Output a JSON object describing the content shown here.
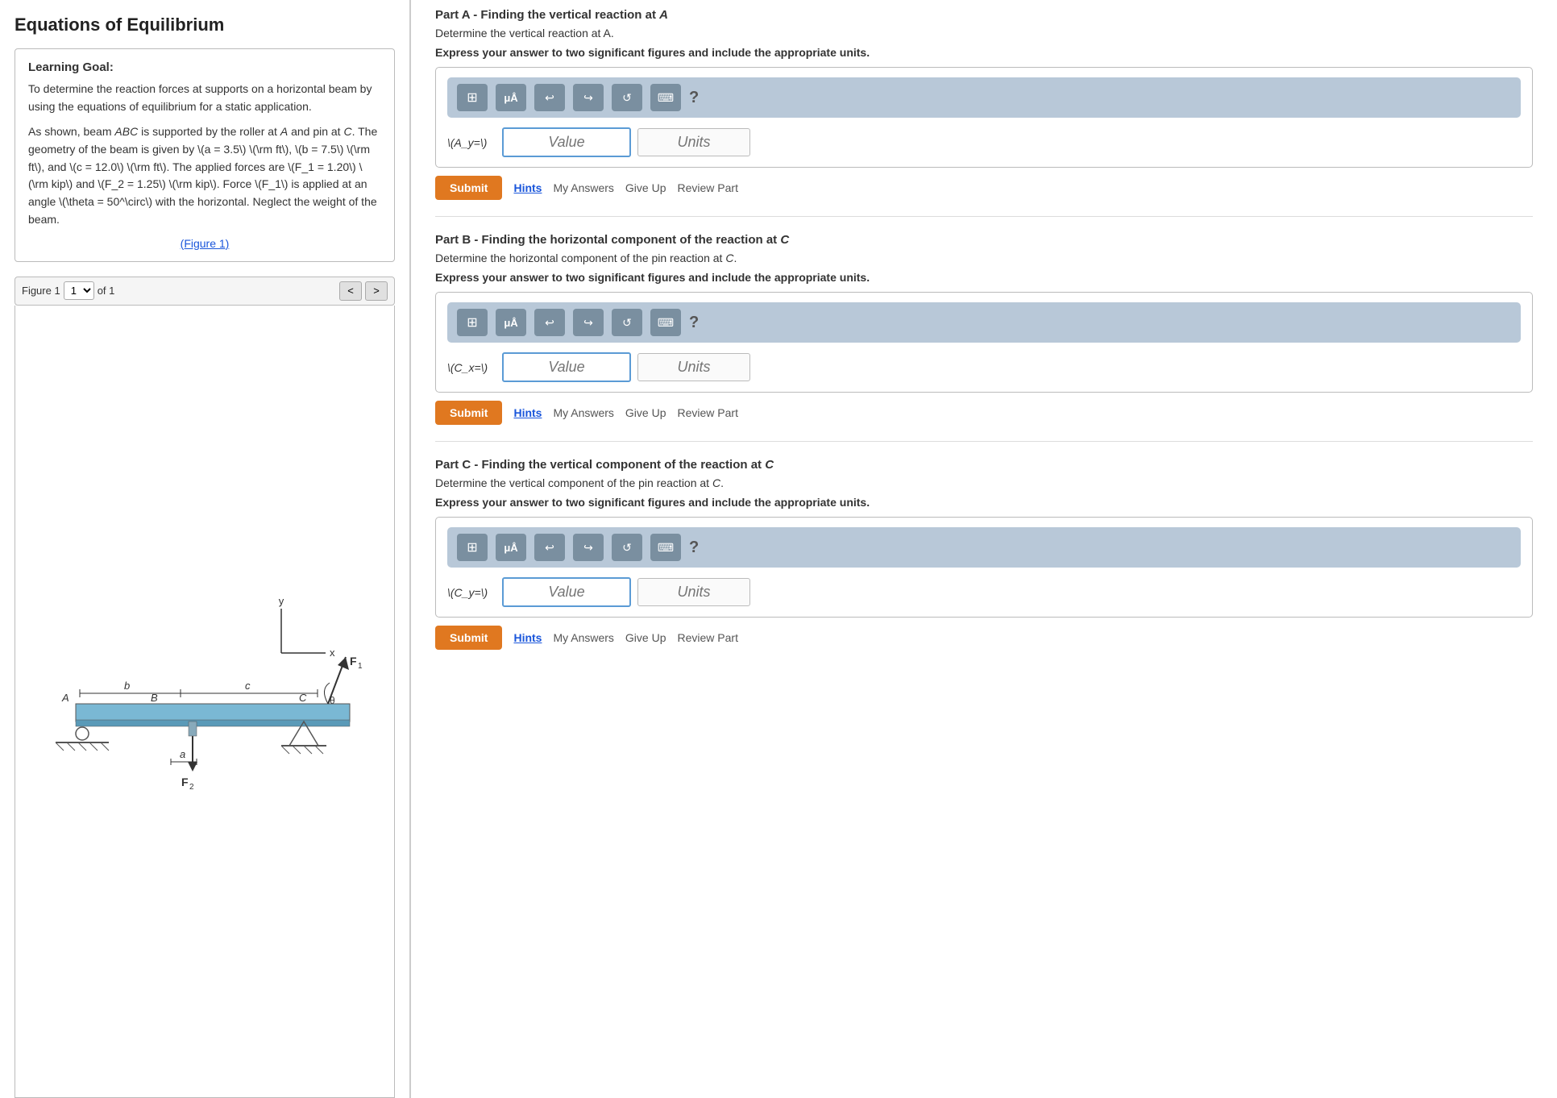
{
  "page": {
    "title": "Equations of Equilibrium"
  },
  "learning_goal": {
    "title": "Learning Goal:",
    "paragraphs": [
      "To determine the reaction forces at supports on a horizontal beam by using the equations of equilibrium for a static application.",
      "As shown, beam ABC is supported by the roller at A and pin at C. The geometry of the beam is given by \\(a = 3.5\\) \\(\\rm ft\\), \\(b = 7.5\\) \\(\\rm ft\\), and \\(c = 12.0\\) \\(\\rm ft\\). The applied forces are \\(F_1 = 1.20\\) \\(\\rm kip\\) and \\(F_2 = 1.25\\) \\(\\rm kip\\). Force \\(F_1\\) is applied at an angle \\(\\theta = 50^\\circ\\) with the horizontal. Neglect the weight of the beam."
    ],
    "figure_link": "(Figure 1)"
  },
  "figure_nav": {
    "label": "Figure 1",
    "current": "1",
    "total": "of 1",
    "prev_label": "<",
    "next_label": ">"
  },
  "parts": [
    {
      "id": "partA",
      "title_prefix": "Part A -",
      "title_text": "Finding the vertical reaction at A",
      "desc": "Determine the vertical reaction at A.",
      "instruction": "Express your answer to two significant figures and include the appropriate units.",
      "label": "\\(A_y=\\)",
      "value_placeholder": "Value",
      "units_placeholder": "Units",
      "submit_label": "Submit",
      "hints_label": "Hints",
      "my_answers_label": "My Answers",
      "give_up_label": "Give Up",
      "review_part_label": "Review Part"
    },
    {
      "id": "partB",
      "title_prefix": "Part B -",
      "title_text": "Finding the horizontal component of the reaction at C",
      "desc": "Determine the horizontal component of the pin reaction at C.",
      "instruction": "Express your answer to two significant figures and include the appropriate units.",
      "label": "\\(C_x=\\)",
      "value_placeholder": "Value",
      "units_placeholder": "Units",
      "submit_label": "Submit",
      "hints_label": "Hints",
      "my_answers_label": "My Answers",
      "give_up_label": "Give Up",
      "review_part_label": "Review Part"
    },
    {
      "id": "partC",
      "title_prefix": "Part C -",
      "title_text": "Finding the vertical component of the reaction at C",
      "desc": "Determine the vertical component of the pin reaction at C.",
      "instruction": "Express your answer to two significant figures and include the appropriate units.",
      "label": "\\(C_y=\\)",
      "value_placeholder": "Value",
      "units_placeholder": "Units",
      "submit_label": "Submit",
      "hints_label": "Hints",
      "my_answers_label": "My Answers",
      "give_up_label": "Give Up",
      "review_part_label": "Review Part"
    }
  ],
  "toolbar": {
    "grid_icon": "⊞",
    "mu_icon": "μÅ",
    "undo_icon": "↩",
    "redo_icon": "↪",
    "refresh_icon": "↺",
    "keyboard_icon": "⌨",
    "question_icon": "?"
  },
  "colors": {
    "submit_bg": "#e07820",
    "toolbar_bg": "#b8c8d8",
    "toolbar_btn": "#7a8fa0",
    "value_border": "#5b9bd5",
    "link_color": "#1a56db"
  }
}
